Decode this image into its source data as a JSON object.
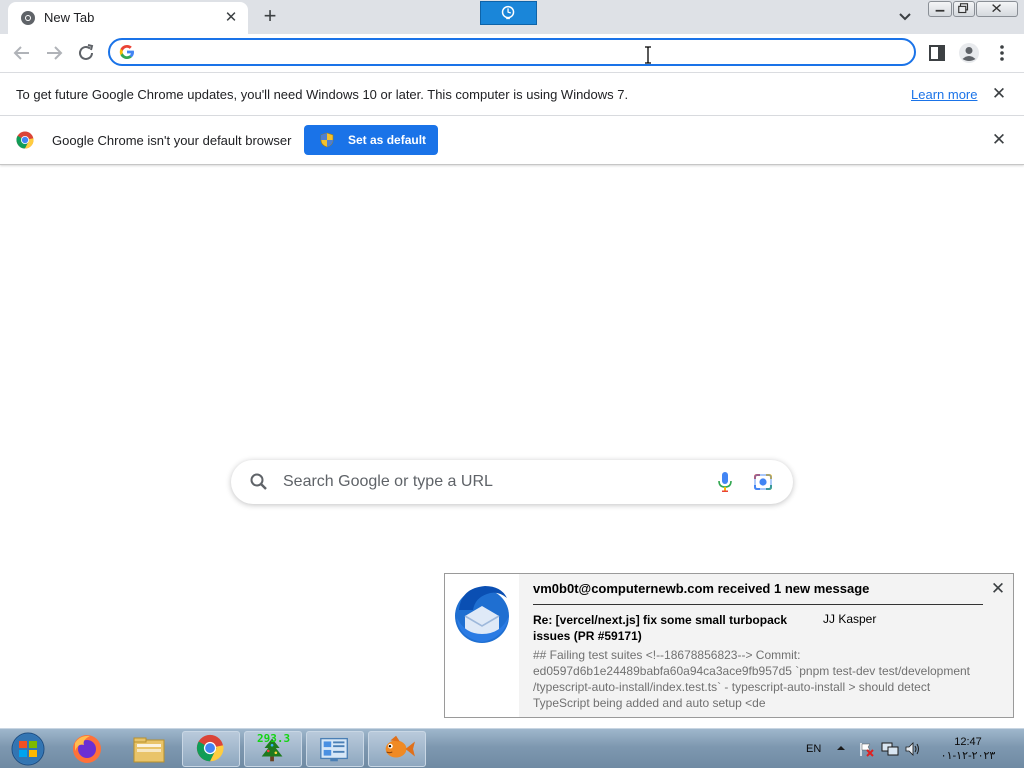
{
  "tab": {
    "title": "New Tab"
  },
  "infobar_update": {
    "message": "To get future Google Chrome updates, you'll need Windows 10 or later. This computer is using Windows 7.",
    "link": "Learn more"
  },
  "infobar_default": {
    "message": "Google Chrome isn't your default browser",
    "button": "Set as default"
  },
  "ntp": {
    "search_placeholder": "Search Google or type a URL"
  },
  "notification": {
    "header": "vm0b0t@computernewb.com received 1 new message",
    "subject": "Re: [vercel/next.js] fix some small turbopack issues (PR #59171)",
    "sender": "JJ Kasper",
    "preview": "## Failing test suites <!--18678856823--> Commit: ed0597d6b1e24489babfa60a94ca3ace9fb957d5 `pnpm test-dev test/development /typescript-auto-install/index.test.ts` - typescript-auto-install > should detect TypeScript being added and auto setup <de"
  },
  "taskbar": {
    "items": [
      "start-orb",
      "firefox",
      "file-explorer",
      "chrome",
      "tree-app",
      "control-panel",
      "fish-app"
    ],
    "tree_app_counter": "293.3",
    "language": "EN",
    "time": "12:47",
    "date": "٢٠٢٣-١٢-٠١"
  },
  "colors": {
    "accent": "#1a73e8",
    "tabstrip": "#dee1e6",
    "taskbar": "#7e98b0"
  }
}
